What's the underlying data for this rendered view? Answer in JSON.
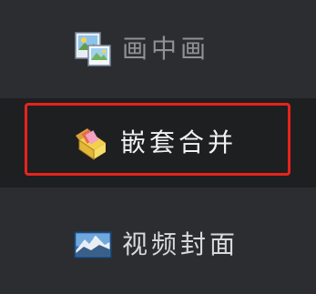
{
  "menu": {
    "items": [
      {
        "label": "画中画",
        "icon": "picture-in-picture-icon"
      },
      {
        "label": "嵌套合并",
        "icon": "nested-merge-folder-icon"
      },
      {
        "label": "视频封面",
        "icon": "video-cover-landscape-icon"
      }
    ],
    "highlight_color": "#e8231c",
    "background_color": "#2b2d30",
    "selected_background_color": "#1e1f21"
  }
}
